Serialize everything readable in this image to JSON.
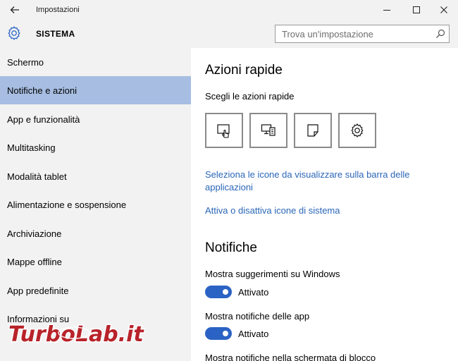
{
  "window": {
    "title": "Impostazioni",
    "back_icon": "back-arrow-icon",
    "controls": [
      "minimize-icon",
      "maximize-icon",
      "close-icon"
    ]
  },
  "header": {
    "section_icon": "gear-icon",
    "section_title": "SISTEMA",
    "search": {
      "placeholder": "Trova un'impostazione",
      "value": "",
      "icon": "search-icon"
    }
  },
  "sidebar": {
    "items": [
      {
        "label": "Schermo",
        "active": false
      },
      {
        "label": "Notifiche e azioni",
        "active": true
      },
      {
        "label": "App e funzionalità",
        "active": false
      },
      {
        "label": "Multitasking",
        "active": false
      },
      {
        "label": "Modalità tablet",
        "active": false
      },
      {
        "label": "Alimentazione e sospensione",
        "active": false
      },
      {
        "label": "Archiviazione",
        "active": false
      },
      {
        "label": "Mappe offline",
        "active": false
      },
      {
        "label": "App predefinite",
        "active": false
      },
      {
        "label": "Informazioni su",
        "active": false
      }
    ],
    "active_color": "#a7bee2"
  },
  "main": {
    "quick_actions": {
      "heading": "Azioni rapide",
      "subheading": "Scegli le azioni rapide",
      "tiles": [
        "tablet-mode-icon",
        "project-icon",
        "note-icon",
        "settings-icon"
      ]
    },
    "links": {
      "taskbar_icons": "Seleziona le icone da visualizzare sulla barra delle applicazioni",
      "system_icons": "Attiva o disattiva icone di sistema"
    },
    "notifications": {
      "heading": "Notifiche",
      "settings": [
        {
          "label": "Mostra suggerimenti su Windows",
          "state": "Attivato",
          "on": true
        },
        {
          "label": "Mostra notifiche delle app",
          "state": "Attivato",
          "on": true
        },
        {
          "label": "Mostra notifiche nella schermata di blocco"
        }
      ]
    },
    "accent_color": "#2b63c4",
    "link_color": "#2a66b8"
  },
  "watermark": {
    "text": "TurboLab.it"
  }
}
